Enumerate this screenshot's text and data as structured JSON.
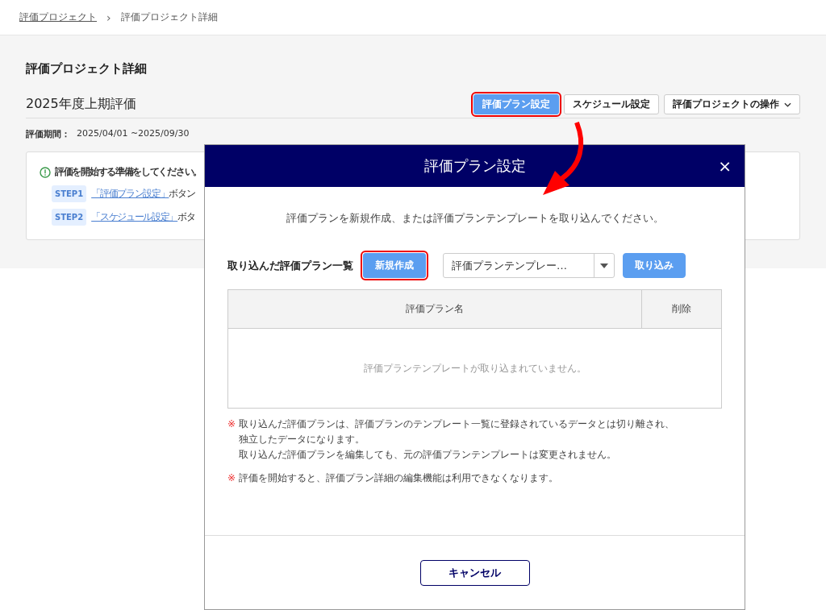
{
  "breadcrumb": [
    {
      "label": "評価プロジェクト",
      "link": true
    },
    {
      "label": "評価プロジェクト詳細",
      "link": false
    }
  ],
  "breadcrumb_separator": "›",
  "page_title": "評価プロジェクト詳細",
  "project": {
    "name": "2025年度上期評価",
    "period_label": "評価期間：",
    "period": "2025/04/01 ~2025/09/30"
  },
  "actions": [
    {
      "label": "評価プラン設定",
      "kind": "primary",
      "highlighted": true
    },
    {
      "label": "スケジュール設定",
      "kind": "default",
      "highlighted": false
    },
    {
      "label": "評価プロジェクトの操作",
      "kind": "dropdown",
      "highlighted": false
    }
  ],
  "notice": {
    "title": "評価を開始する準備をしてください。",
    "steps": [
      {
        "badge": "STEP1",
        "link": "「評価プラン設定」",
        "text": "ボタン"
      },
      {
        "badge": "STEP2",
        "link": "「スケジュール設定」",
        "text": "ボタ"
      }
    ]
  },
  "dialog": {
    "title": "評価プラン設定",
    "close": "×",
    "intro": "評価プランを新規作成、または評価プランテンプレートを取り込んでください。",
    "list_label": "取り込んだ評価プラン一覧",
    "new_button": {
      "label": "新規作成",
      "highlighted": true
    },
    "template_select": {
      "value": "評価プランテンプレー…"
    },
    "import_button": "取り込み",
    "table": {
      "columns": [
        "評価プラン名",
        "削除"
      ],
      "empty": "評価プランテンプレートが取り込まれていません。"
    },
    "notes": [
      {
        "mark": "※",
        "lines": [
          "取り込んだ評価プランは、評価プランのテンプレート一覧に登録されているデータとは切り離され、",
          "独立したデータになります。",
          "取り込んだ評価プランを編集しても、元の評価プランテンプレートは変更されません。"
        ]
      },
      {
        "mark": "※",
        "lines": [
          "評価を開始すると、評価プラン詳細の編集機能は利用できなくなります。"
        ]
      }
    ],
    "cancel": "キャンセル"
  }
}
